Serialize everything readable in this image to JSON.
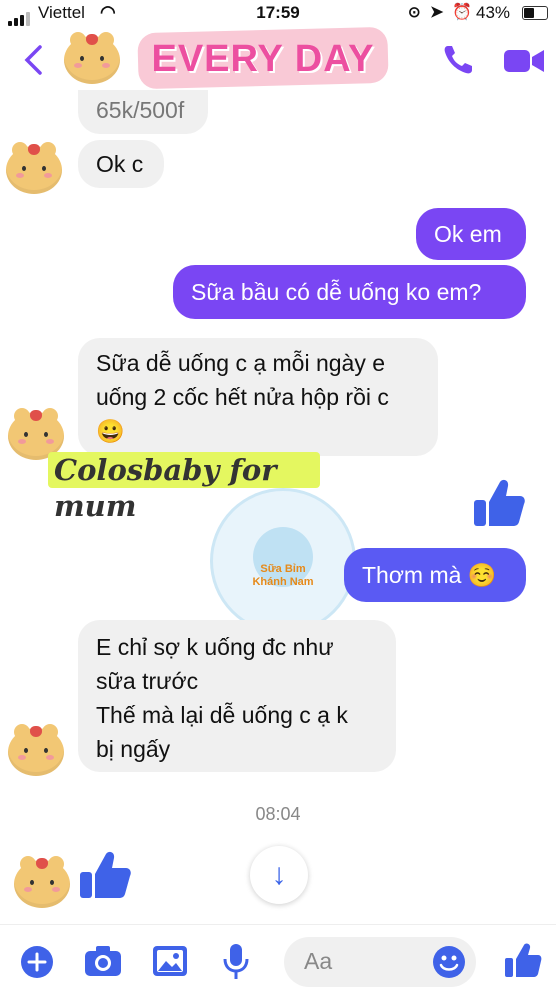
{
  "status_bar": {
    "carrier": "Viettel",
    "time": "17:59",
    "battery": "43%"
  },
  "header": {
    "title": "EVERY DAY",
    "back_icon": "chevron-left-icon",
    "call_icon": "phone-icon",
    "video_icon": "video-camera-icon"
  },
  "messages": [
    {
      "side": "in",
      "text": "65k/500f"
    },
    {
      "side": "in",
      "text": "Ok c"
    },
    {
      "side": "out",
      "text": "Ok em"
    },
    {
      "side": "out",
      "text": "Sữa bầu có dễ uống ko em?"
    },
    {
      "side": "in",
      "lines": [
        "Sữa dễ uống c ạ mỗi ngày e",
        "uống 2 cốc hết nửa hộp rồi c",
        "😀"
      ]
    },
    {
      "side": "out",
      "text": "Thơm mà ☺️"
    },
    {
      "side": "in",
      "lines": [
        "E chỉ sợ k uống đc như",
        "sữa trước",
        "Thế mà lại dễ uống c ạ k",
        "bị ngấy"
      ]
    }
  ],
  "sticker": {
    "text": "Colosbaby for mum"
  },
  "stamp": {
    "name_line1": "Sữa Bỉm",
    "name_line2": "Khánh Nam"
  },
  "timestamp": "08:04",
  "composer": {
    "placeholder": "Aa",
    "icons": [
      "plus-icon",
      "camera-icon",
      "image-icon",
      "microphone-icon",
      "emoji-icon",
      "thumbs-up-icon"
    ]
  },
  "colors": {
    "accent": "#7a46f3",
    "like": "#3f62e8",
    "incoming_bubble": "#f0f0f0"
  }
}
